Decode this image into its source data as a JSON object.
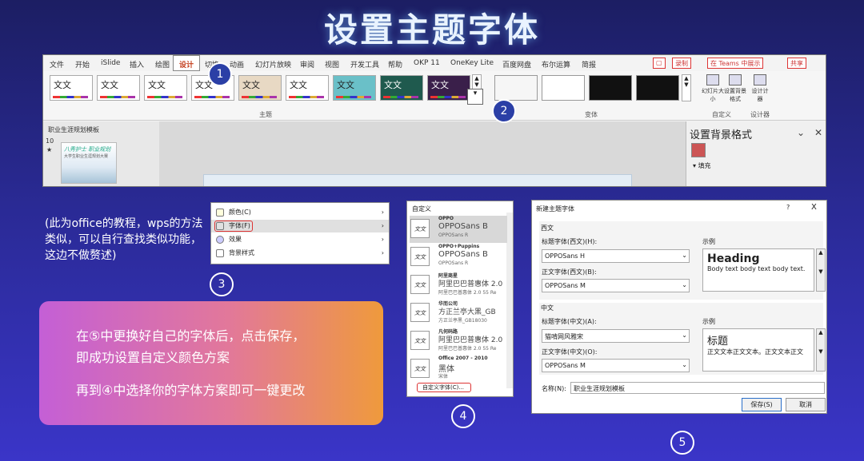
{
  "page": {
    "title": "设置主题字体"
  },
  "ribbon": {
    "menu": [
      "文件",
      "开始",
      "iSlide",
      "插入",
      "绘图",
      "设计",
      "切换",
      "动画",
      "幻灯片放映",
      "审阅",
      "视图",
      "开发工具",
      "帮助",
      "OKP 11",
      "OneKey Lite",
      "百度网盘",
      "布尔运算",
      "简报"
    ],
    "active_menu": "设计",
    "record_label": "录制",
    "teams_label": "在 Teams 中展示",
    "share_label": "共享",
    "theme_label": "文文",
    "group_theme": "主题",
    "group_variant": "变体",
    "group_custom": "自定义",
    "group_designer": "设计器",
    "tools": {
      "slide_size": "幻灯片大小",
      "format_bg": "设置背景格式",
      "designer": "设计计器"
    },
    "thumb_pane_title": "职业生涯规划模板",
    "slide_number": "10",
    "slide_star": "★",
    "slide_thumb_text": "八秀护士 职业规划",
    "slide_thumb_sub": "大学生职业生涯规划大赛",
    "format_pane_title": "设置背景格式",
    "format_fill": "填充"
  },
  "steps": [
    "1",
    "2",
    "3",
    "4",
    "5"
  ],
  "note": "(此为office的教程，wps的方法类似，可以自行查找类似功能，这边不做赘述)",
  "gbox": {
    "line1": "在⑤中更换好自己的字体后，点击保存，",
    "line2": "即成功设置自定义颜色方案",
    "line3": "再到④中选择你的字体方案即可一键更改"
  },
  "menu3": {
    "items": [
      "颜色(C)",
      "字体(F)",
      "效果",
      "背景样式"
    ],
    "icons": [
      "palette-icon",
      "font-icon",
      "effects-icon",
      "background-style-icon"
    ]
  },
  "fontlist": {
    "header": "自定义",
    "items": [
      {
        "small": "OPPO",
        "big": "OPPOSans B",
        "sub": "OPPOSans R"
      },
      {
        "small": "OPPO+Puppins",
        "big": "OPPOSans B",
        "sub": "OPPOSans R"
      },
      {
        "small": "阿里商星",
        "big": "阿里巴巴普惠体 2.0",
        "sub": "阿里巴巴普惠体 2.0 55 Re"
      },
      {
        "small": "华而公司",
        "big": "方正兰亭大黑_GB",
        "sub": "方正兰亭黑_GB18030"
      },
      {
        "small": "凡何码路",
        "big": "阿里巴巴普惠体 2.0",
        "sub": "阿里巴巴普惠体 2.0 55 Re"
      },
      {
        "small": "Office 2007 - 2010",
        "big": "黑体",
        "sub": "宋体"
      }
    ],
    "icon_label": "文文",
    "custom_button": "自定义字体(C)..."
  },
  "dialog": {
    "title": "新建主题字体",
    "help": "?",
    "close": "X",
    "western": "西文",
    "heading_w_label": "标题字体(西文)(H):",
    "heading_w_value": "OPPOSans H",
    "body_w_label": "正文字体(西文)(B):",
    "body_w_value": "OPPOSans M",
    "sample_label": "示例",
    "preview_w_heading": "Heading",
    "preview_w_body": "Body text body text body text.",
    "chinese": "中文",
    "heading_c_label": "标题字体(中文)(A):",
    "heading_c_value": "猫啃网风雅宋",
    "body_c_label": "正文字体(中文)(O):",
    "body_c_value": "OPPOSans M",
    "preview_c_heading": "标题",
    "preview_c_body": "正文文本正文文本。正文文本正文",
    "name_label": "名称(N):",
    "name_value": "职业生涯规划模板",
    "save": "保存(S)",
    "cancel": "取消"
  },
  "colors": {
    "bg_top": "#1c1e63",
    "bg_bottom": "#3a35c8",
    "accent_red": "#d33333",
    "gradient_start": "#c45fd6",
    "gradient_end": "#ef9a3c"
  }
}
